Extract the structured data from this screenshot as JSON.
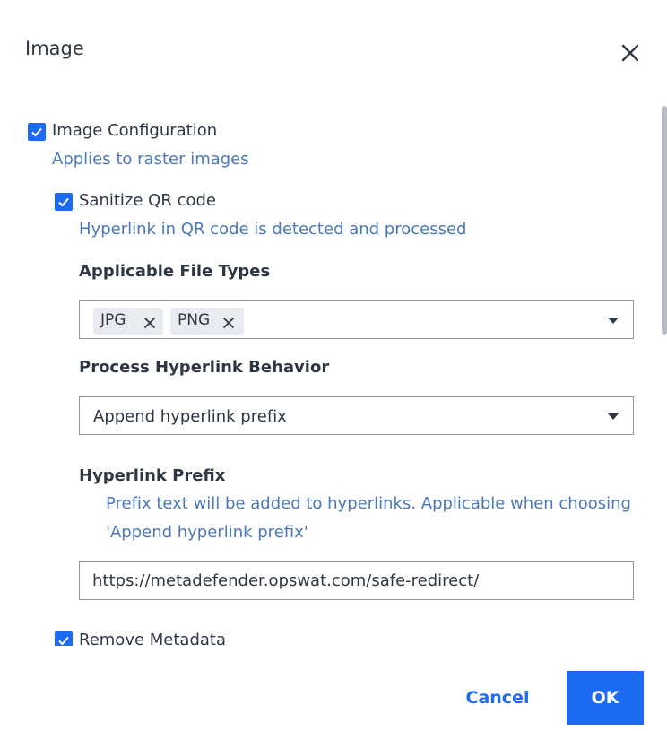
{
  "dialog": {
    "title": "Image",
    "close_icon": "close-icon"
  },
  "image_configuration": {
    "checked": true,
    "label": "Image Configuration",
    "help": "Applies to raster images"
  },
  "sanitize_qr": {
    "checked": true,
    "label": "Sanitize QR code",
    "help": "Hyperlink in QR code is detected and processed"
  },
  "file_types": {
    "label": "Applicable File Types",
    "chips": [
      "JPG",
      "PNG"
    ]
  },
  "hyperlink_behavior": {
    "label": "Process Hyperlink Behavior",
    "value": "Append hyperlink prefix"
  },
  "hyperlink_prefix": {
    "label": "Hyperlink Prefix",
    "help_line1": "Prefix text will be added to hyperlinks. Applicable when choosing",
    "help_line2": "'Append hyperlink prefix'",
    "value": "https://metadefender.opswat.com/safe-redirect/"
  },
  "remove_metadata": {
    "checked": true,
    "label": "Remove Metadata"
  },
  "footer": {
    "cancel_label": "Cancel",
    "ok_label": "OK"
  },
  "colors": {
    "accent": "#1d6bf3",
    "help_text": "#4b78b8",
    "text": "#2f3744"
  }
}
